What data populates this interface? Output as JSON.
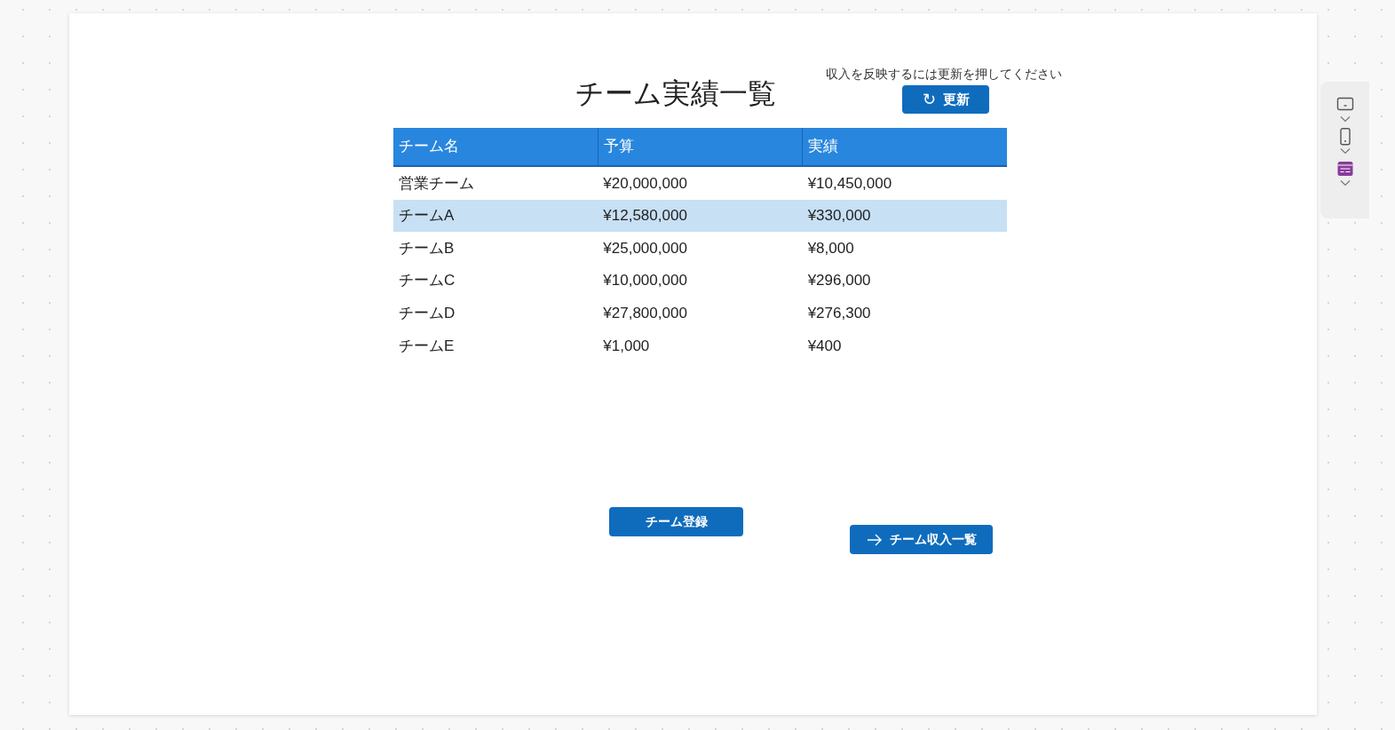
{
  "screen": {
    "title": "チーム実績一覧",
    "hint": "収入を反映するには更新を押してください",
    "refresh_button": {
      "icon": "↻",
      "label": "更新"
    },
    "table": {
      "columns": [
        "チーム名",
        "予算",
        "実績"
      ],
      "rows": [
        {
          "cells": [
            "営業チーム",
            "¥20,000,000",
            "¥10,450,000"
          ],
          "selected": false
        },
        {
          "cells": [
            "チームA",
            "¥12,580,000",
            "¥330,000"
          ],
          "selected": true
        },
        {
          "cells": [
            "チームB",
            "¥25,000,000",
            "¥8,000"
          ],
          "selected": false
        },
        {
          "cells": [
            "チームC",
            "¥10,000,000",
            "¥296,000"
          ],
          "selected": false
        },
        {
          "cells": [
            "チームD",
            "¥27,800,000",
            "¥276,300"
          ],
          "selected": false
        },
        {
          "cells": [
            "チームE",
            "¥1,000",
            "¥400"
          ],
          "selected": false
        }
      ]
    },
    "register_button": {
      "label": "チーム登録"
    },
    "income_button": {
      "label": "チーム収入一覧"
    }
  },
  "side_toolbar": [
    {
      "kind": "tablet",
      "selected": false
    },
    {
      "kind": "phone",
      "selected": false
    },
    {
      "kind": "form",
      "selected": true
    }
  ]
}
